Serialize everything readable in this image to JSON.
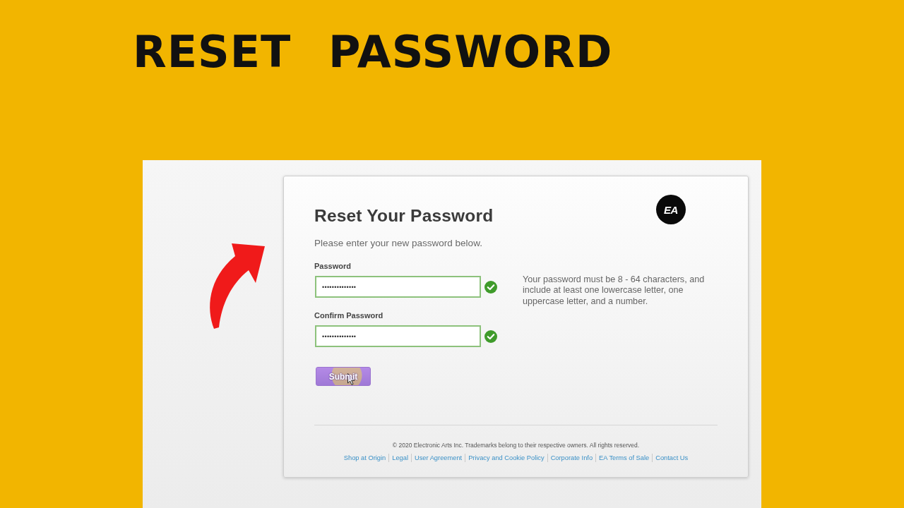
{
  "title": "RESET PASSWORD",
  "page": {
    "logo_text": "EA",
    "heading": "Reset Your Password",
    "subtitle": "Please enter your new password below.",
    "fields": [
      {
        "label": "Password",
        "value": "••••••••••••••",
        "valid": true
      },
      {
        "label": "Confirm Password",
        "value": "••••••••••••••",
        "valid": true
      }
    ],
    "hint": "Your password must be 8 - 64 characters, and include at least one lowercase letter, one uppercase letter, and a number.",
    "submit": {
      "label": "Submit"
    },
    "copyright": "© 2020 Electronic Arts Inc. Trademarks belong to their respective owners. All rights reserved.",
    "footer_links": [
      "Shop at Origin",
      "Legal",
      "User Agreement",
      "Privacy and Cookie Policy",
      "Corporate Info",
      "EA Terms of Sale",
      "Contact Us"
    ]
  }
}
